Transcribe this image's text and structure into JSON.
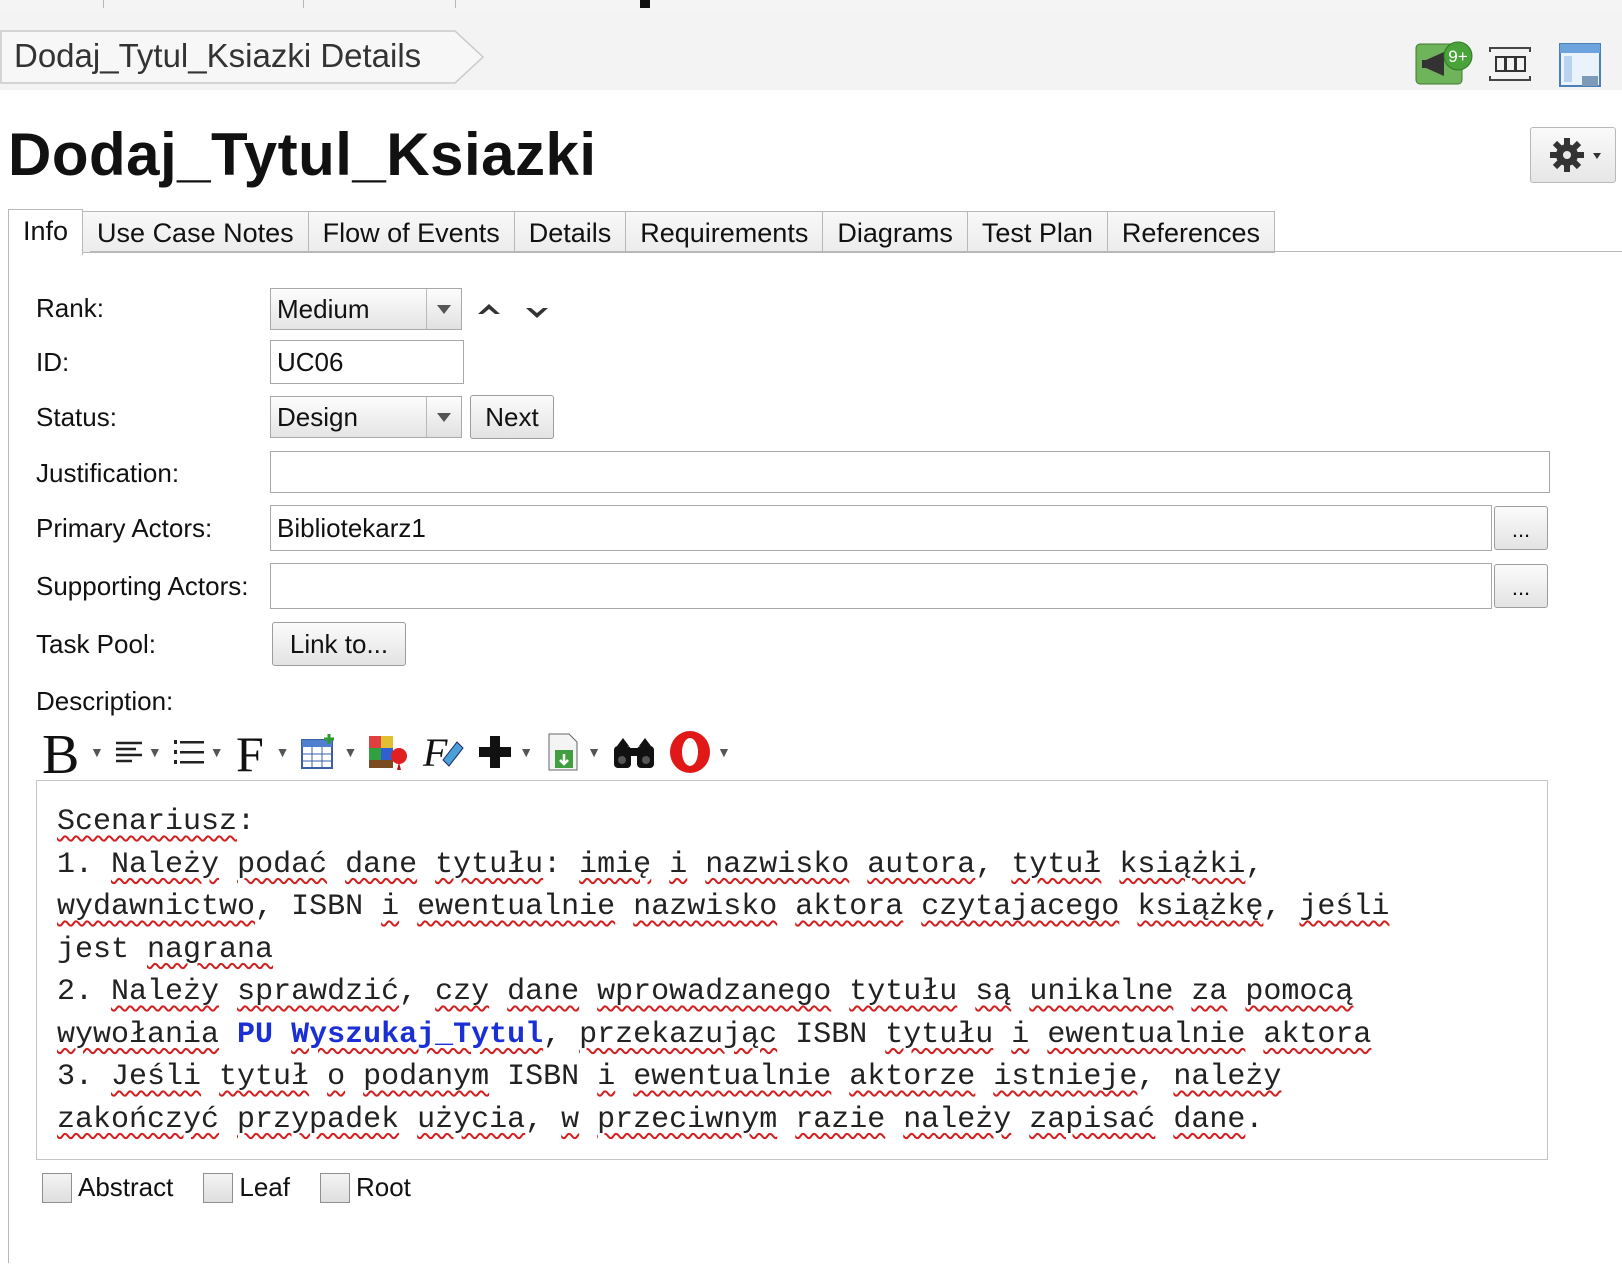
{
  "breadcrumb": "Dodaj_Tytul_Ksiazki Details",
  "notification_badge": "9+",
  "title": "Dodaj_Tytul_Ksiazki",
  "tabs": [
    "Info",
    "Use Case Notes",
    "Flow of Events",
    "Details",
    "Requirements",
    "Diagrams",
    "Test Plan",
    "References"
  ],
  "form": {
    "rank_label": "Rank:",
    "rank_value": "Medium",
    "id_label": "ID:",
    "id_value": "UC06",
    "status_label": "Status:",
    "status_value": "Design",
    "next_button": "Next",
    "justification_label": "Justification:",
    "justification_value": "",
    "primary_actors_label": "Primary Actors:",
    "primary_actors_value": "Bibliotekarz1",
    "supporting_actors_label": "Supporting Actors:",
    "supporting_actors_value": "",
    "browse_button": "...",
    "task_pool_label": "Task Pool:",
    "link_button": "Link to...",
    "description_label": "Description:"
  },
  "description": {
    "heading": "Scenariusz",
    "l1a": "Należy",
    "l1b": "podać",
    "l1c": "dane",
    "l1d": "tytułu",
    "l1e": "imię",
    "l1f": "i",
    "l1g": "nazwisko",
    "l1h": "autora",
    "l1i": "tytuł",
    "l1j": "książki",
    "l2a": "wydawnictwo",
    "l2b": "ISBN",
    "l2c": "i",
    "l2d": "ewentualnie",
    "l2e": "nazwisko",
    "l2f": "aktora",
    "l2g": "czytajacego",
    "l2h": "książkę",
    "l2i": "jeśli",
    "l3a": "jest",
    "l3b": "nagrana",
    "l4a": "Należy",
    "l4b": "sprawdzić",
    "l4c": "czy",
    "l4d": "dane",
    "l4e": "wprowadzanego",
    "l4f": "tytułu",
    "l4g": "są",
    "l4h": "unikalne",
    "l4i": "za",
    "l4j": "pomocą",
    "l5a": "wywołania",
    "l5link1": "PU",
    "l5link2": "Wyszukaj_Tytul",
    "l5b": "przekazując",
    "l5c": "ISBN",
    "l5d": "tytułu",
    "l5e": "i",
    "l5f": "ewentualnie",
    "l5g": "aktora",
    "l6a": "Jeśli",
    "l6b": "tytuł",
    "l6c": "o",
    "l6d": "podanym",
    "l6e": "ISBN",
    "l6f": "i",
    "l6g": "ewentualnie",
    "l6h": "aktorze",
    "l6i": "istnieje",
    "l6j": "należy",
    "l7a": "zakończyć",
    "l7b": "przypadek",
    "l7c": "użycia",
    "l7d": "w",
    "l7e": "przeciwnym",
    "l7f": "razie",
    "l7g": "należy",
    "l7h": "zapisać",
    "l7i": "dane"
  },
  "checkboxes": [
    "Abstract",
    "Leaf",
    "Root"
  ],
  "icons": [
    "megaphone-icon",
    "fit-view-icon",
    "layout-panel-icon",
    "gear-icon",
    "bold-icon",
    "align-icon",
    "list-icon",
    "font-icon",
    "table-icon",
    "color-icon",
    "clear-format-icon",
    "insert-icon",
    "attach-icon",
    "find-icon",
    "spellcheck-icon"
  ]
}
